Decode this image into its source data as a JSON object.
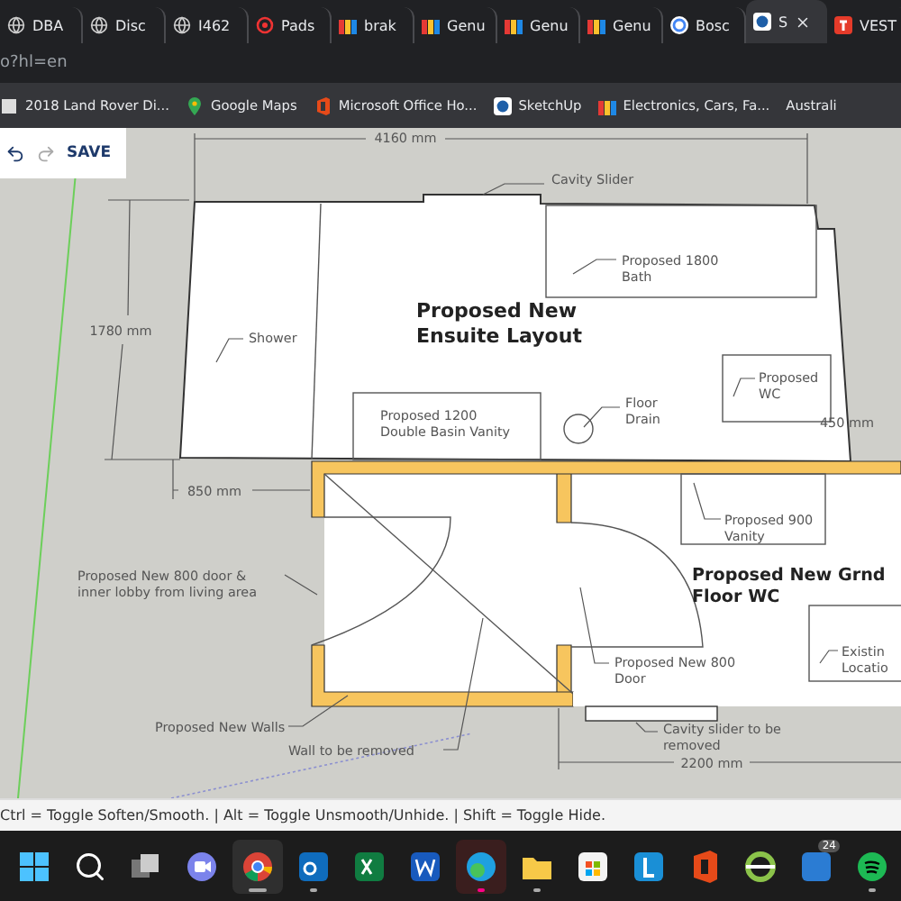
{
  "tabs": [
    {
      "kind": "globe",
      "label": "DBA",
      "selected": false
    },
    {
      "kind": "globe",
      "label": "Disc",
      "selected": false
    },
    {
      "kind": "globe",
      "label": "I462",
      "selected": false
    },
    {
      "kind": "target",
      "label": "Pads",
      "selected": false
    },
    {
      "kind": "stripes",
      "label": "brak",
      "selected": false
    },
    {
      "kind": "stripes",
      "label": "Genu",
      "selected": false
    },
    {
      "kind": "stripes",
      "label": "Genu",
      "selected": false
    },
    {
      "kind": "stripes",
      "label": "Genu",
      "selected": false
    },
    {
      "kind": "google",
      "label": "Bosc",
      "selected": false
    },
    {
      "kind": "sketchup",
      "label": "S",
      "selected": true
    },
    {
      "kind": "letter",
      "label": "VEST",
      "selected": false
    }
  ],
  "address": {
    "value": "o?hl=en"
  },
  "bookmarks": [
    {
      "kind": "page",
      "label": "2018 Land Rover Di..."
    },
    {
      "kind": "maps",
      "label": "Google Maps"
    },
    {
      "kind": "office",
      "label": "Microsoft Office Ho..."
    },
    {
      "kind": "sketchup",
      "label": "SketchUp"
    },
    {
      "kind": "stripes",
      "label": "Electronics, Cars, Fa..."
    },
    {
      "kind": "none",
      "label": "Australi"
    }
  ],
  "toolbar": {
    "save": "SAVE"
  },
  "plan": {
    "labels": [
      {
        "kind": "dimension",
        "lines": [
          "4160 mm"
        ]
      },
      {
        "kind": "note",
        "lines": [
          "Cavity Slider"
        ]
      },
      {
        "kind": "note",
        "lines": [
          "Proposed 1800",
          "Bath"
        ]
      },
      {
        "kind": "dimension",
        "lines": [
          "1780 mm"
        ]
      },
      {
        "kind": "note",
        "lines": [
          "Shower"
        ]
      },
      {
        "kind": "title",
        "lines": [
          "Proposed New",
          "Ensuite Layout"
        ]
      },
      {
        "kind": "note",
        "lines": [
          "Proposed",
          "WC"
        ]
      },
      {
        "kind": "note",
        "lines": [
          "Proposed 1200",
          "Double Basin Vanity"
        ]
      },
      {
        "kind": "note",
        "lines": [
          "Floor",
          "Drain"
        ]
      },
      {
        "kind": "dimension",
        "lines": [
          "450 mm"
        ]
      },
      {
        "kind": "dimension",
        "lines": [
          "850 mm"
        ]
      },
      {
        "kind": "note",
        "lines": [
          "Proposed 900",
          "Vanity"
        ]
      },
      {
        "kind": "note",
        "lines": [
          "Proposed New 800 door &",
          "inner lobby from living area"
        ]
      },
      {
        "kind": "title",
        "lines": [
          "Proposed New Grnd",
          "Floor WC"
        ]
      },
      {
        "kind": "note",
        "lines": [
          "Proposed New 800",
          "Door"
        ]
      },
      {
        "kind": "note",
        "lines": [
          "Existin",
          "Locatio"
        ]
      },
      {
        "kind": "note",
        "lines": [
          "Proposed New Walls"
        ]
      },
      {
        "kind": "note",
        "lines": [
          "Cavity slider to be",
          "removed"
        ]
      },
      {
        "kind": "note",
        "lines": [
          "Wall to be removed"
        ]
      },
      {
        "kind": "dimension",
        "lines": [
          "2200 mm"
        ]
      }
    ]
  },
  "status_bar": "Ctrl = Toggle Soften/Smooth. | Alt = Toggle Unsmooth/Unhide. | Shift = Toggle Hide.",
  "taskbar": [
    {
      "kind": "start",
      "running": false,
      "active": false
    },
    {
      "kind": "search",
      "running": false,
      "active": false
    },
    {
      "kind": "taskview",
      "running": false,
      "active": false
    },
    {
      "kind": "chat",
      "running": false,
      "active": false
    },
    {
      "kind": "chrome",
      "running": true,
      "active": true
    },
    {
      "kind": "outlook",
      "running": true,
      "active": false
    },
    {
      "kind": "excel",
      "running": false,
      "active": false
    },
    {
      "kind": "word",
      "running": false,
      "active": false
    },
    {
      "kind": "edge",
      "running": true,
      "active": false,
      "alert": true
    },
    {
      "kind": "explorer",
      "running": true,
      "active": false
    },
    {
      "kind": "store",
      "running": false,
      "active": false
    },
    {
      "kind": "letter",
      "running": false,
      "active": false
    },
    {
      "kind": "office",
      "running": false,
      "active": false
    },
    {
      "kind": "ring",
      "running": false,
      "active": false
    },
    {
      "kind": "teams",
      "running": false,
      "active": false,
      "badge": "24"
    },
    {
      "kind": "spotify",
      "running": true,
      "active": false
    }
  ]
}
